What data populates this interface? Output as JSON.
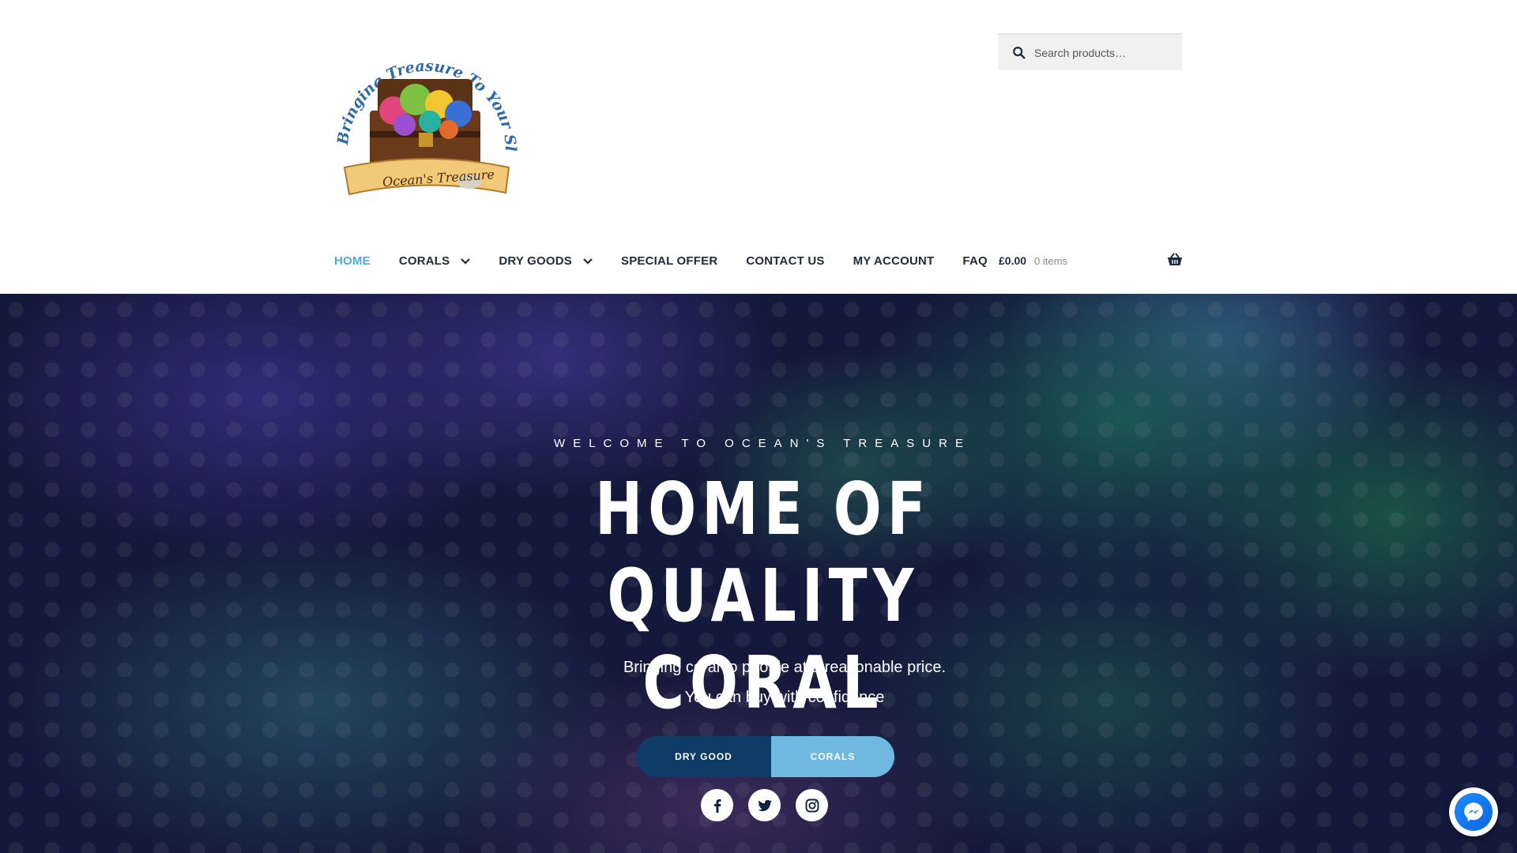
{
  "header": {
    "logo": {
      "arc_text": "Bringing Treasure To Your Slice Of Ocean",
      "banner_text": "Ocean's Treasure"
    },
    "search": {
      "placeholder": "Search products…"
    },
    "nav": [
      {
        "label": "HOME",
        "active": true,
        "has_dropdown": false
      },
      {
        "label": "CORALS",
        "active": false,
        "has_dropdown": true
      },
      {
        "label": "DRY GOODS",
        "active": false,
        "has_dropdown": true
      },
      {
        "label": "SPECIAL OFFER",
        "active": false,
        "has_dropdown": false
      },
      {
        "label": "CONTACT US",
        "active": false,
        "has_dropdown": false
      },
      {
        "label": "MY ACCOUNT",
        "active": false,
        "has_dropdown": false
      },
      {
        "label": "FAQ",
        "active": false,
        "has_dropdown": false
      }
    ],
    "cart": {
      "amount": "£0.00",
      "count": "0 items",
      "icon": "basket-icon"
    }
  },
  "hero": {
    "kicker": "WELCOME TO OCEAN'S TREASURE",
    "headline_line1": "HOME OF QUALITY",
    "headline_line2": "CORAL",
    "subtitle_line1": "Bringing coral to people at a reasonable price.",
    "subtitle_line2": "You can buy with confidence",
    "buttons": [
      {
        "label": "DRY GOOD"
      },
      {
        "label": "CORALS"
      }
    ],
    "socials": [
      "facebook-icon",
      "twitter-icon",
      "instagram-icon"
    ]
  },
  "colors": {
    "nav_text": "#1e2b3c",
    "nav_active": "#56a8d8",
    "button_dark": "#0e3c66",
    "button_light": "#6fb9e0",
    "messenger_blue": "#0a66e0"
  },
  "floating": {
    "messenger_icon": "messenger-icon"
  }
}
